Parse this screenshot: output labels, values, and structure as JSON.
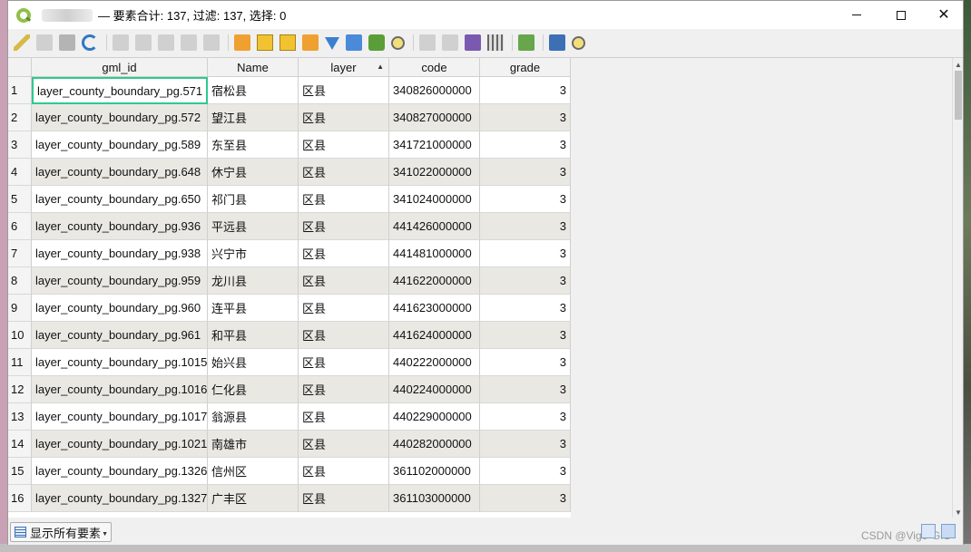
{
  "window": {
    "title": "— 要素合计: 137, 过滤: 137, 选择: 0"
  },
  "toolbar": {
    "icons": [
      "toggle-edit-icon",
      "multi-edit-icon",
      "save-edits-icon",
      "reload-icon",
      "add-feature-icon",
      "delete-feature-icon",
      "cut-icon",
      "copy-icon",
      "paste-icon",
      "select-by-expression-icon",
      "select-all-icon",
      "invert-selection-icon",
      "deselect-all-icon",
      "filter-select-icon",
      "move-selection-to-top-icon",
      "pan-to-selected-icon",
      "zoom-to-selected-icon",
      "new-field-icon",
      "delete-field-icon",
      "field-calculator-icon",
      "conditional-formatting-icon",
      "actions-icon",
      "dock-icon",
      "zoom-map-icon"
    ]
  },
  "table": {
    "columns": [
      "gml_id",
      "Name",
      "layer",
      "code",
      "grade"
    ],
    "sorted_column": "layer",
    "rows": [
      {
        "n": "1",
        "gml_id": "layer_county_boundary_pg.571",
        "name": "宿松县",
        "layer": "区县",
        "code": "340826000000",
        "grade": "3"
      },
      {
        "n": "2",
        "gml_id": "layer_county_boundary_pg.572",
        "name": "望江县",
        "layer": "区县",
        "code": "340827000000",
        "grade": "3"
      },
      {
        "n": "3",
        "gml_id": "layer_county_boundary_pg.589",
        "name": "东至县",
        "layer": "区县",
        "code": "341721000000",
        "grade": "3"
      },
      {
        "n": "4",
        "gml_id": "layer_county_boundary_pg.648",
        "name": "休宁县",
        "layer": "区县",
        "code": "341022000000",
        "grade": "3"
      },
      {
        "n": "5",
        "gml_id": "layer_county_boundary_pg.650",
        "name": "祁门县",
        "layer": "区县",
        "code": "341024000000",
        "grade": "3"
      },
      {
        "n": "6",
        "gml_id": "layer_county_boundary_pg.936",
        "name": "平远县",
        "layer": "区县",
        "code": "441426000000",
        "grade": "3"
      },
      {
        "n": "7",
        "gml_id": "layer_county_boundary_pg.938",
        "name": "兴宁市",
        "layer": "区县",
        "code": "441481000000",
        "grade": "3"
      },
      {
        "n": "8",
        "gml_id": "layer_county_boundary_pg.959",
        "name": "龙川县",
        "layer": "区县",
        "code": "441622000000",
        "grade": "3"
      },
      {
        "n": "9",
        "gml_id": "layer_county_boundary_pg.960",
        "name": "连平县",
        "layer": "区县",
        "code": "441623000000",
        "grade": "3"
      },
      {
        "n": "10",
        "gml_id": "layer_county_boundary_pg.961",
        "name": "和平县",
        "layer": "区县",
        "code": "441624000000",
        "grade": "3"
      },
      {
        "n": "11",
        "gml_id": "layer_county_boundary_pg.1015",
        "name": "始兴县",
        "layer": "区县",
        "code": "440222000000",
        "grade": "3"
      },
      {
        "n": "12",
        "gml_id": "layer_county_boundary_pg.1016",
        "name": "仁化县",
        "layer": "区县",
        "code": "440224000000",
        "grade": "3"
      },
      {
        "n": "13",
        "gml_id": "layer_county_boundary_pg.1017",
        "name": "翁源县",
        "layer": "区县",
        "code": "440229000000",
        "grade": "3"
      },
      {
        "n": "14",
        "gml_id": "layer_county_boundary_pg.1021",
        "name": "南雄市",
        "layer": "区县",
        "code": "440282000000",
        "grade": "3"
      },
      {
        "n": "15",
        "gml_id": "layer_county_boundary_pg.1326",
        "name": "信州区",
        "layer": "区县",
        "code": "361102000000",
        "grade": "3"
      },
      {
        "n": "16",
        "gml_id": "layer_county_boundary_pg.1327",
        "name": "广丰区",
        "layer": "区县",
        "code": "361103000000",
        "grade": "3"
      }
    ]
  },
  "statusbar": {
    "filter_label": "显示所有要素",
    "watermark": "CSDN @Vigo*GIS"
  }
}
